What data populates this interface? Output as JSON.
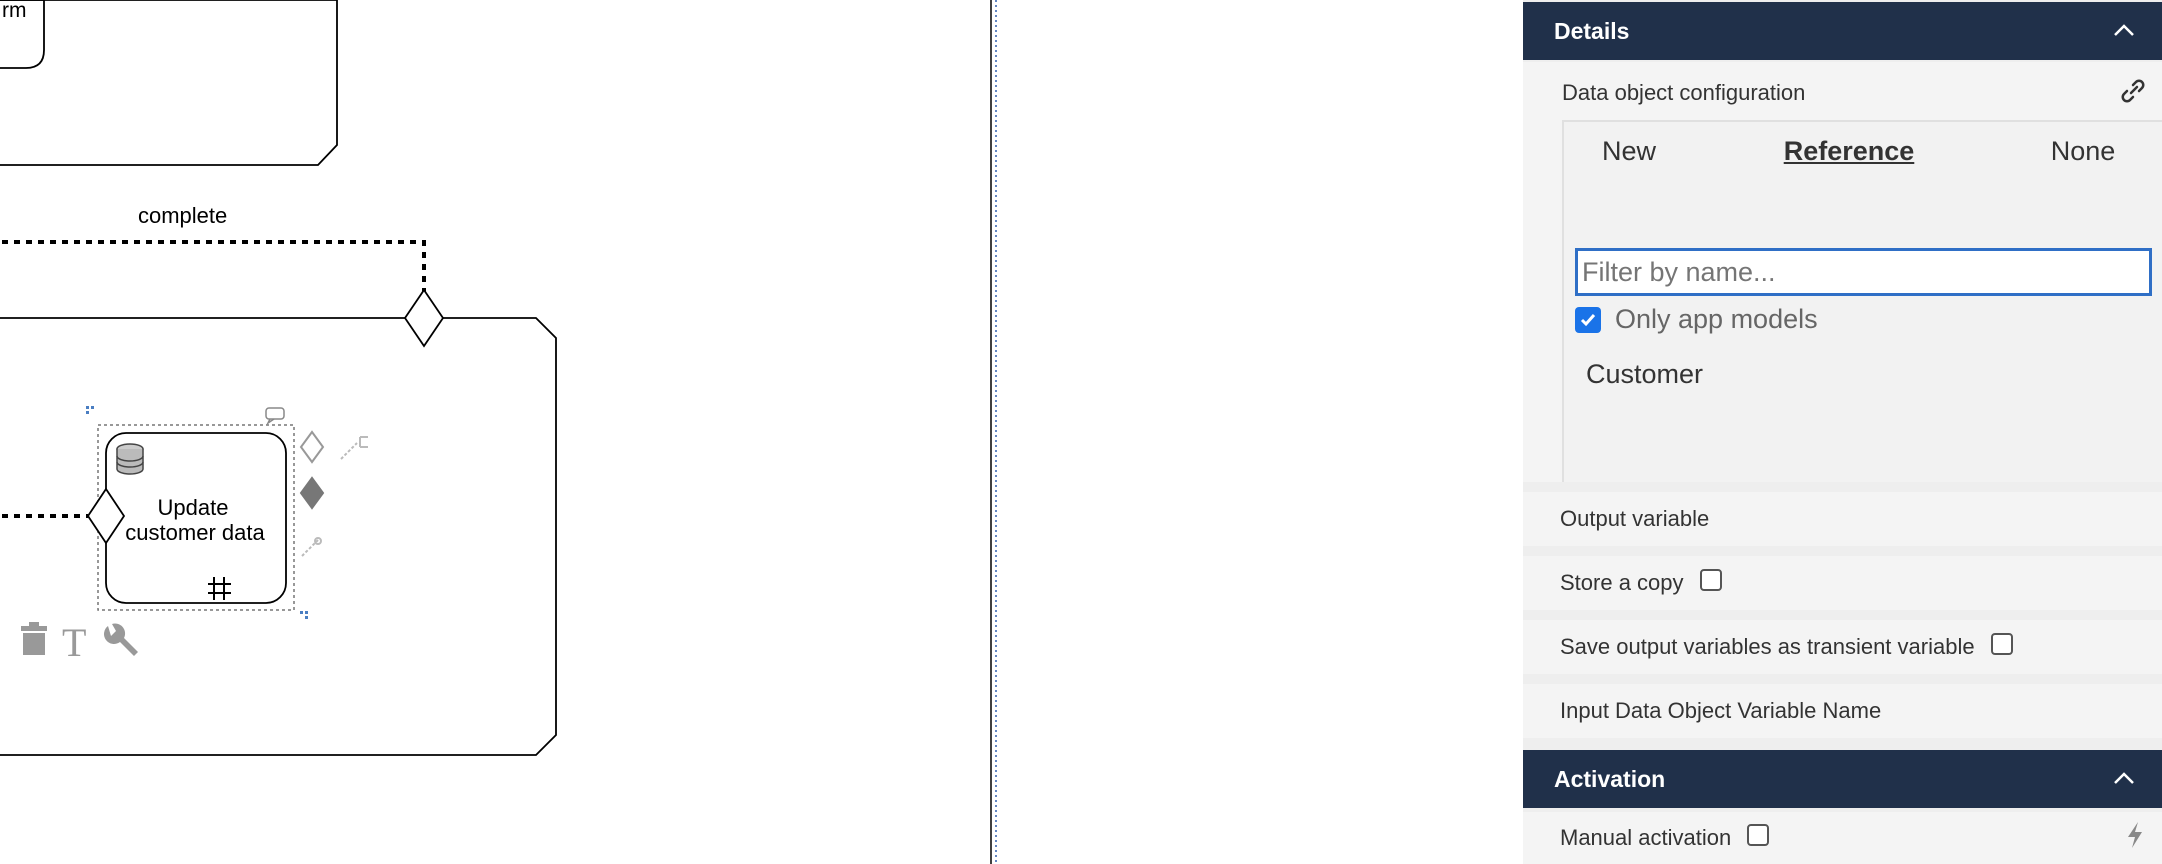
{
  "canvas": {
    "partial_task_label": "rm",
    "flow_label": "complete",
    "task_label_line1": "Update",
    "task_label_line2": "customer data"
  },
  "panel": {
    "details": {
      "title": "Details",
      "data_object_configuration": {
        "label": "Data object configuration",
        "tabs": [
          "New",
          "Reference",
          "None"
        ],
        "selected_tab": "Reference",
        "filter_placeholder": "Filter by name...",
        "filter_value": "",
        "only_app_models_label": "Only app models",
        "only_app_models_checked": true,
        "results": [
          "Customer"
        ]
      },
      "output_variable_label": "Output variable",
      "store_copy_label": "Store a copy",
      "store_copy_checked": false,
      "save_transient_label": "Save output variables as transient variable",
      "save_transient_checked": false,
      "input_data_object_label": "Input Data Object Variable Name"
    },
    "activation": {
      "title": "Activation",
      "manual_activation_label": "Manual activation",
      "manual_activation_checked": false
    }
  },
  "colors": {
    "header_bg": "#20304a",
    "accent": "#2f6fc6",
    "checkbox_checked": "#1a73e8"
  },
  "icons": [
    "chevron-up-icon",
    "link-icon",
    "checkmark-icon",
    "bolt-icon",
    "database-icon",
    "parallel-marker-icon",
    "trash-icon",
    "text-icon",
    "wrench-icon",
    "gateway-icon",
    "connector-icon"
  ]
}
